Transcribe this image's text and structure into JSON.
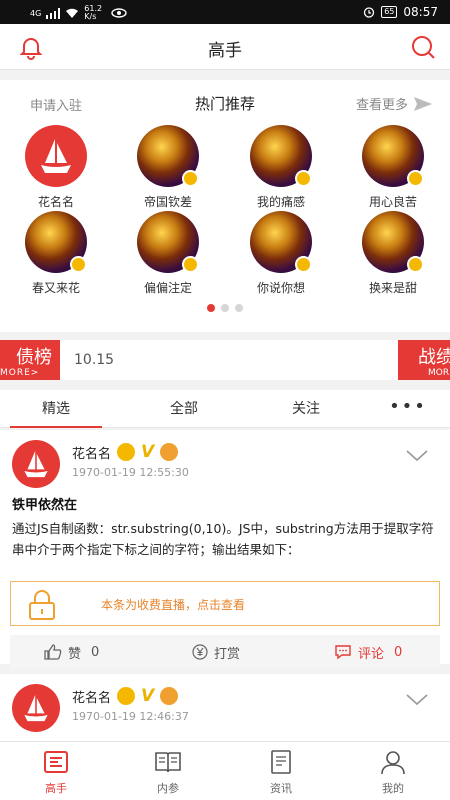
{
  "status": {
    "net": "4G",
    "speed": "61.2 K/s",
    "battery": "65",
    "time": "08:57"
  },
  "header": {
    "title": "高手"
  },
  "recommend": {
    "apply_label": "申请入驻",
    "title": "热门推荐",
    "more_label": "查看更多",
    "masters": [
      {
        "name": "花名名",
        "avatar": "logo"
      },
      {
        "name": "帝国钦差",
        "avatar": "dragon"
      },
      {
        "name": "我的痛感",
        "avatar": "dragon"
      },
      {
        "name": "用心良苦",
        "avatar": "dragon"
      },
      {
        "name": "春又来花",
        "avatar": "dragon"
      },
      {
        "name": "偏偏注定",
        "avatar": "dragon"
      },
      {
        "name": "你说你想",
        "avatar": "dragon"
      },
      {
        "name": "换来是甜",
        "avatar": "dragon"
      }
    ],
    "page_dots": 3,
    "active_dot": 0
  },
  "ticker": {
    "left_title": "债榜",
    "left_sub": "MORE>",
    "text": "10.15",
    "right_title": "战绩",
    "right_sub": "MORE"
  },
  "tabs": [
    {
      "label": "精选",
      "active": true
    },
    {
      "label": "全部",
      "active": false
    },
    {
      "label": "关注",
      "active": false
    },
    {
      "label": "•••",
      "active": false
    }
  ],
  "posts": [
    {
      "user": "花名名",
      "time": "1970-01-19  12:55:30",
      "title": "铁甲依然在",
      "body": "通过JS自制函数：str.substring(0,10)。JS中，substring方法用于提取字符串中介于两个指定下标之间的字符；输出结果如下：",
      "paywall": "本条为收费直播，点击查看",
      "like_label": "赞",
      "like_count": "0",
      "reward_label": "打赏",
      "comment_label": "评论",
      "comment_count": "0"
    },
    {
      "user": "花名名",
      "time": "1970-01-19  12:46:37"
    }
  ],
  "nav": [
    {
      "label": "高手",
      "icon": "master-icon",
      "active": true
    },
    {
      "label": "内参",
      "icon": "book-icon",
      "active": false
    },
    {
      "label": "资讯",
      "icon": "news-icon",
      "active": false
    },
    {
      "label": "我的",
      "icon": "user-icon",
      "active": false
    }
  ],
  "colors": {
    "accent": "#e53935",
    "pay_border": "#f0b860",
    "pay_text": "#e8842a"
  }
}
